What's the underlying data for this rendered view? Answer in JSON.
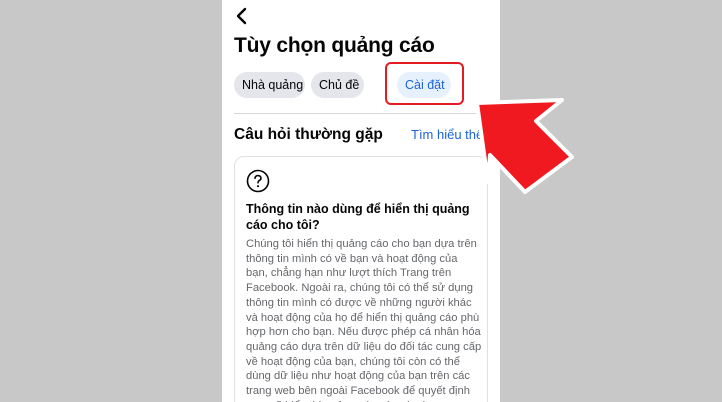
{
  "header": {
    "title": "Tùy chọn quảng cáo"
  },
  "tabs": [
    {
      "label": "Nhà quảng"
    },
    {
      "label": "Chủ đề"
    },
    {
      "label": "Cài đặt"
    }
  ],
  "faq": {
    "heading": "Câu hỏi thường gặp",
    "learn_more": "Tìm hiểu thê",
    "question": "Thông tin nào dùng để hiển thị quảng cáo cho tôi?",
    "answer": "Chúng tôi hiển thị quảng cáo cho bạn dựa trên thông tin mình có về bạn và hoạt động của bạn, chẳng hạn như lượt thích Trang trên Facebook. Ngoài ra, chúng tôi có thể sử dụng thông tin mình có được về những người khác và hoạt động của họ để hiển thị quảng cáo phù hợp hơn cho bạn. Nếu được phép cá nhân hóa quảng cáo dựa trên dữ liệu do đối tác cung cấp về hoạt động của bạn, chúng tôi còn có thể dùng dữ liệu như hoạt động của bạn trên các trang web bên ngoài Facebook để quyết định xem sẽ hiển thị quảng cáo nào cho bạn."
  },
  "icons": {
    "back": "chevron-left-icon",
    "question": "question-circle-icon",
    "annotation": "red-arrow-icon"
  },
  "colors": {
    "accent": "#1b63d8",
    "selected_chip_bg": "#e7f0fd",
    "chip_bg": "#e4e6eb",
    "highlight": "#e41b23",
    "arrow": "#f0191f"
  }
}
